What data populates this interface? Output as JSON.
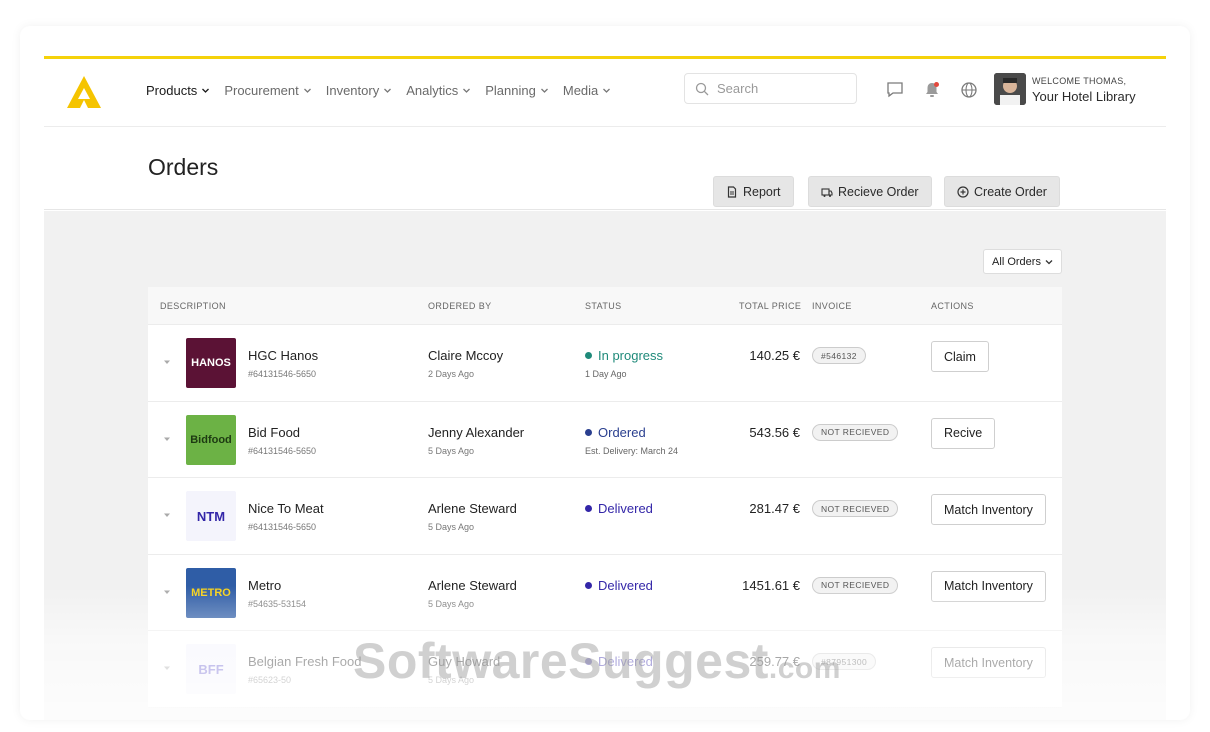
{
  "nav": {
    "items": [
      {
        "label": "Products",
        "active": true
      },
      {
        "label": "Procurement",
        "active": false
      },
      {
        "label": "Inventory",
        "active": false
      },
      {
        "label": "Analytics",
        "active": false
      },
      {
        "label": "Planning",
        "active": false
      },
      {
        "label": "Media",
        "active": false
      }
    ],
    "search_placeholder": "Search",
    "icons": [
      "chat-icon",
      "bell-icon",
      "globe-icon"
    ],
    "welcome": "WELCOME THOMAS,",
    "library": "Your Hotel Library"
  },
  "header": {
    "title": "Orders",
    "buttons": [
      {
        "label": "Report",
        "icon": "report-icon"
      },
      {
        "label": "Recieve Order",
        "icon": "truck-icon"
      },
      {
        "label": "Create Order",
        "icon": "plus-circle-icon"
      }
    ]
  },
  "filter": {
    "selected": "All Orders"
  },
  "table": {
    "headers": [
      "DESCRIPTION",
      "ORDERED BY",
      "STATUS",
      "TOTAL PRICE",
      "INVOICE",
      "ACTIONS"
    ],
    "rows": [
      {
        "logo_text": "HANOS",
        "logo_bg": "#5b1235",
        "logo_color": "#ffffff",
        "name": "HGC Hanos",
        "id": "#64131546-5650",
        "ordered_by": "Claire Mccoy",
        "ordered_time": "2 Days Ago",
        "status": "In progress",
        "status_color": "#1f8a7a",
        "status_sub": "1 Day Ago",
        "price": "140.25 €",
        "invoice": "#546132",
        "action": "Claim"
      },
      {
        "logo_text": "Bidfood",
        "logo_bg": "#6cb245",
        "logo_color": "#1d3a12",
        "name": "Bid Food",
        "id": "#64131546-5650",
        "ordered_by": "Jenny Alexander",
        "ordered_time": "5 Days Ago",
        "status": "Ordered",
        "status_color": "#2a3f8f",
        "status_sub": "Est. Delivery: March 24",
        "price": "543.56 €",
        "invoice": "NOT RECIEVED",
        "action": "Recive"
      },
      {
        "logo_text": "NTM",
        "logo_bg": "#f4f4fc",
        "logo_color": "#3326a8",
        "name": "Nice To Meat",
        "id": "#64131546-5650",
        "ordered_by": "Arlene Steward",
        "ordered_time": "5 Days Ago",
        "status": "Delivered",
        "status_color": "#3326a8",
        "status_sub": "",
        "price": "281.47 €",
        "invoice": "NOT RECIEVED",
        "action": "Match Inventory"
      },
      {
        "logo_text": "METRO",
        "logo_bg": "#2f5da6",
        "logo_color": "#f7d117",
        "name": "Metro",
        "id": "#54635-53154",
        "ordered_by": "Arlene Steward",
        "ordered_time": "5 Days Ago",
        "status": "Delivered",
        "status_color": "#3326a8",
        "status_sub": "",
        "price": "1451.61 €",
        "invoice": "NOT RECIEVED",
        "action": "Match Inventory"
      },
      {
        "logo_text": "BFF",
        "logo_bg": "#f4f4fc",
        "logo_color": "#6a5fcf",
        "name": "Belgian Fresh Food",
        "id": "#65623-50",
        "ordered_by": "Guy Howard",
        "ordered_time": "5 Days Ago",
        "status": "Delivered",
        "status_color": "#3326a8",
        "status_sub": "",
        "price": "259.77 €",
        "invoice": "#87951300",
        "action": "Match Inventory"
      }
    ]
  },
  "watermark": {
    "main": "SoftwareSuggest",
    "suffix": ".com"
  },
  "colors": {
    "accent": "#f5d20a",
    "brand": "#f5c400"
  }
}
